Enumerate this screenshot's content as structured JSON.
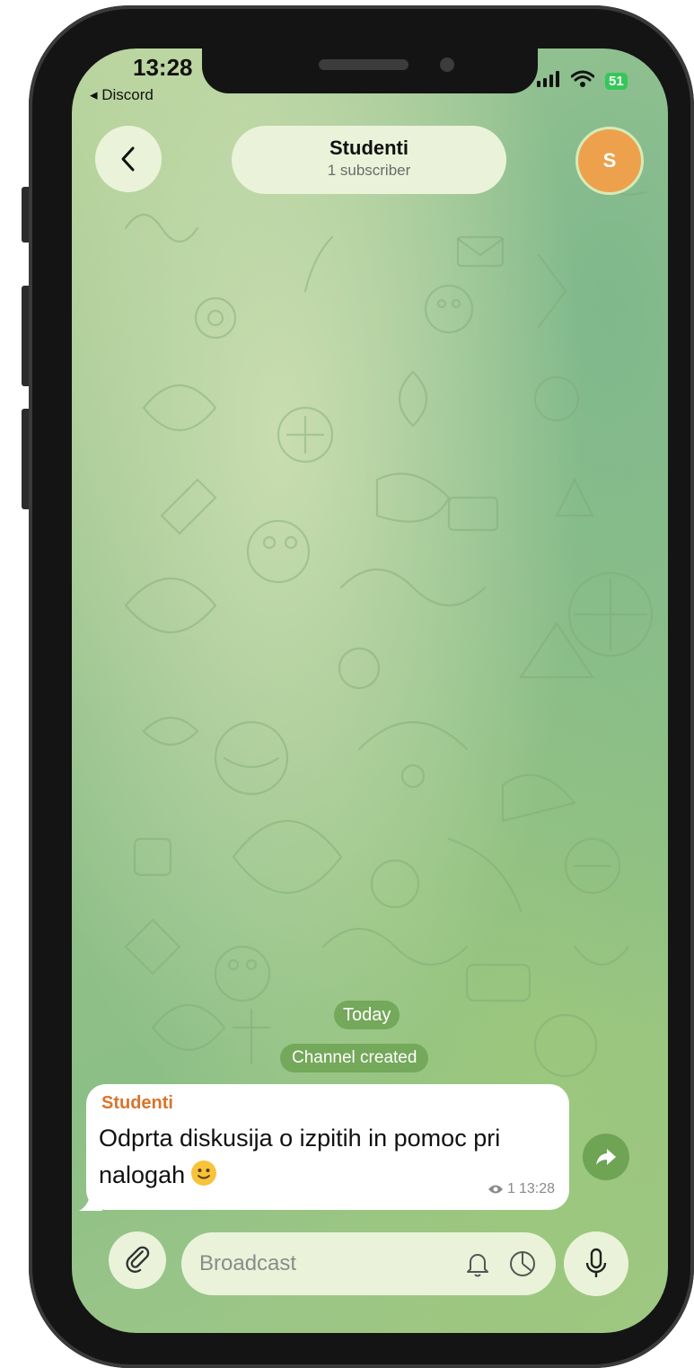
{
  "status_bar": {
    "time": "13:28",
    "back_app": "◂ Discord",
    "battery": "51"
  },
  "header": {
    "title": "Studenti",
    "subtitle": "1 subscriber",
    "avatar_letter": "S"
  },
  "chat": {
    "date_chip": "Today",
    "service_message": "Channel created",
    "message": {
      "sender": "Studenti",
      "text": "Odprta diskusija o izpitih in pomoc pri nalogah",
      "views": "1",
      "time": "13:28"
    }
  },
  "composer": {
    "placeholder": "Broadcast"
  },
  "icons": [
    "back-chevron-icon",
    "signal-icon",
    "wifi-icon",
    "eye-icon",
    "share-arrow-icon",
    "paperclip-icon",
    "bell-icon",
    "timer-icon",
    "microphone-icon",
    "smiley-emoji"
  ],
  "colors": {
    "accent_green": "#6fa455",
    "sender_orange": "#d9742a",
    "avatar_orange": "#eea14c",
    "pill_bg": "#eaf3d9"
  }
}
